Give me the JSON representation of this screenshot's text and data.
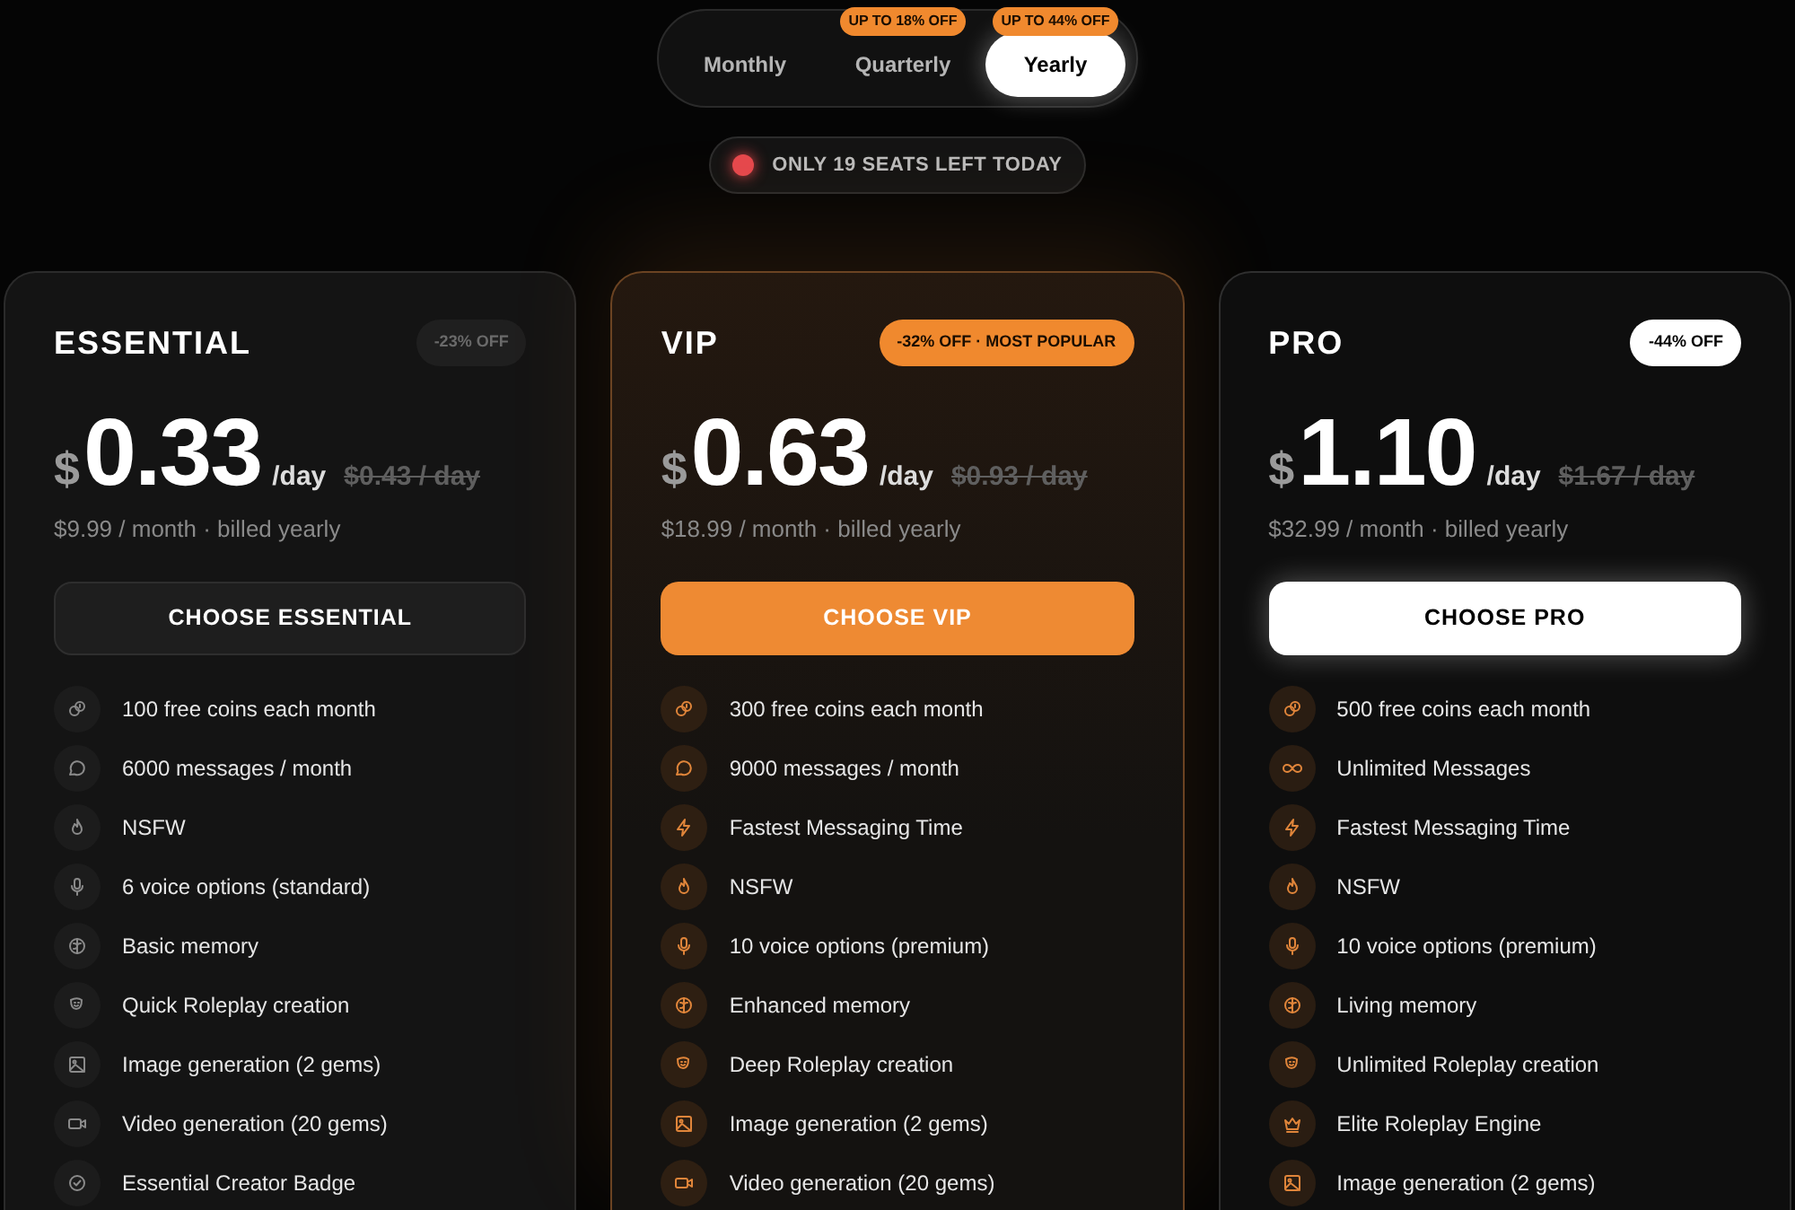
{
  "billing_tabs": [
    {
      "label": "Monthly",
      "selected": false
    },
    {
      "label": "Quarterly",
      "selected": false,
      "badge": "UP TO 18% OFF"
    },
    {
      "label": "Yearly",
      "selected": true,
      "badge": "UP TO 44% OFF"
    }
  ],
  "seats_notice": "ONLY **19** SEATS LEFT TODAY",
  "plans": [
    {
      "kind": "essential",
      "name": "ESSENTIAL",
      "badge": "-23% OFF",
      "currency": "$",
      "price": "0.33",
      "unit": "/day",
      "old_price": "$0.43 / day",
      "billing": "$9.99 / month · billed yearly",
      "button": "CHOOSE ESSENTIAL",
      "features": [
        {
          "kind": "coins",
          "text": "100 free coins each month"
        },
        {
          "kind": "chat",
          "text": "6000 messages / month"
        },
        {
          "kind": "flame",
          "text": "NSFW"
        },
        {
          "kind": "mic",
          "text": "6 voice options (standard)"
        },
        {
          "kind": "brain",
          "text": "Basic memory"
        },
        {
          "kind": "masks",
          "text": "Quick Roleplay creation"
        },
        {
          "kind": "image",
          "text": "Image generation (2 gems)"
        },
        {
          "kind": "video",
          "text": "Video generation (20 gems)"
        },
        {
          "kind": "badge",
          "text": "Essential Creator Badge"
        }
      ]
    },
    {
      "kind": "vip",
      "name": "VIP",
      "badge": "-32% OFF · MOST POPULAR",
      "currency": "$",
      "price": "0.63",
      "unit": "/day",
      "old_price": "$0.93 / day",
      "billing": "$18.99 / month · billed yearly",
      "button": "CHOOSE VIP",
      "features": [
        {
          "kind": "coins",
          "text": "300 free coins each month"
        },
        {
          "kind": "chat",
          "text": "9000 messages / month"
        },
        {
          "kind": "bolt",
          "text": "Fastest Messaging Time"
        },
        {
          "kind": "flame",
          "text": "NSFW"
        },
        {
          "kind": "mic",
          "text": "10 voice options (premium)"
        },
        {
          "kind": "brain",
          "text": "Enhanced memory"
        },
        {
          "kind": "masks",
          "text": "Deep Roleplay creation"
        },
        {
          "kind": "image",
          "text": "Image generation (2 gems)"
        },
        {
          "kind": "video",
          "text": "Video generation (20 gems)"
        }
      ]
    },
    {
      "kind": "pro",
      "name": "PRO",
      "badge": "-44% OFF",
      "currency": "$",
      "price": "1.10",
      "unit": "/day",
      "old_price": "$1.67 / day",
      "billing": "$32.99 / month · billed yearly",
      "button": "CHOOSE PRO",
      "features": [
        {
          "kind": "coins",
          "text": "500 free coins each month"
        },
        {
          "kind": "infinity",
          "text": "Unlimited Messages"
        },
        {
          "kind": "bolt",
          "text": "Fastest Messaging Time"
        },
        {
          "kind": "flame",
          "text": "NSFW"
        },
        {
          "kind": "mic",
          "text": "10 voice options (premium)"
        },
        {
          "kind": "brain",
          "text": "Living memory"
        },
        {
          "kind": "masks",
          "text": "Unlimited Roleplay creation"
        },
        {
          "kind": "crown",
          "text": "Elite Roleplay Engine"
        },
        {
          "kind": "image",
          "text": "Image generation (2 gems)"
        }
      ]
    }
  ]
}
